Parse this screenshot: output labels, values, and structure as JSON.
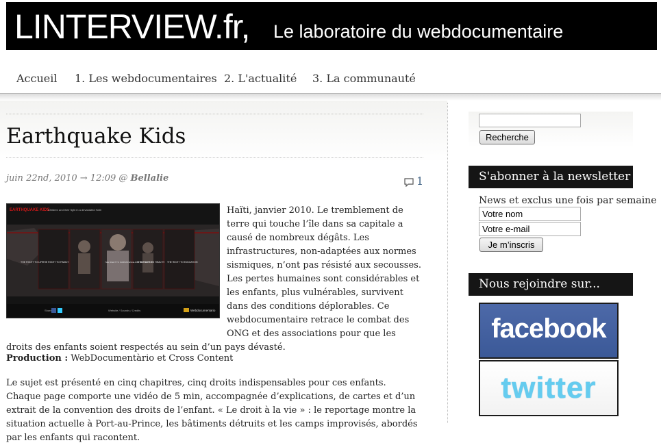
{
  "banner": {
    "logo": "LINTERVIEW.fr,",
    "tagline": "Le laboratoire du webdocumentaire"
  },
  "nav": {
    "items": [
      "Accueil",
      "1. Les webdocumentaires",
      "2. L'actualité",
      "3. La communauté"
    ]
  },
  "post": {
    "title": "Earthquake Kids",
    "date": "juin 22nd, 2010 → 12:09 @",
    "author": "Bellalie",
    "comment_count": "1",
    "thumbnail": {
      "header": "EARTHQUAKE KIDS",
      "subtitle": "Children and their fight in a devastated Haiti",
      "panels": [
        "THE RIGHT TO LIFE",
        "THE RIGHT TO FAMILY",
        "THE RIGHT TO SUBSISTENCE AND PROTECTION",
        "THE RIGHT TO HEALTH",
        "THE RIGHT TO EDUCATION"
      ],
      "footer_left": "Share",
      "footer_center": "Website / Sounds / Credits",
      "footer_right": "Webdocumentario"
    },
    "paragraph1": "Haïti, janvier 2010. Le tremblement de terre qui touche l’île dans sa capitale a causé de nombreux dégâts. Les infrastructures, non-adaptées aux normes sismiques, n’ont pas résisté aux secousses. Les pertes humaines sont considérables et les enfants, plus vulnérables, survivent dans des conditions déplorables. Ce webdocumentaire retrace le combat des ONG et des associations pour que les droits des enfants soient respectés au sein d’un pays dévasté.",
    "production_label": "Production :",
    "production_value": " WebDocumentàrio et Cross Content",
    "paragraph3": "Le sujet est présenté en cinq chapitres, cinq droits indispensables pour ces enfants. Chaque page comporte une vidéo de 5 min, accompagnée d’explications, de cartes et d’un extrait de la convention des droits de l’enfant. « Le droit à la vie » : le reportage montre la situation actuelle à Port-au-Prince, les bâtiments détruits et les camps improvisés, abordés par les enfants qui racontent."
  },
  "sidebar": {
    "search": {
      "value": "",
      "button": "Recherche"
    },
    "newsletter": {
      "title": "S'abonner à la newsletter",
      "text": "News et exclus une fois par semaine",
      "name_value": "Votre nom",
      "email_value": "Votre e-mail",
      "button": "Je m’inscris"
    },
    "social": {
      "title": "Nous rejoindre sur...",
      "facebook": "facebook",
      "twitter": "twitter"
    }
  }
}
